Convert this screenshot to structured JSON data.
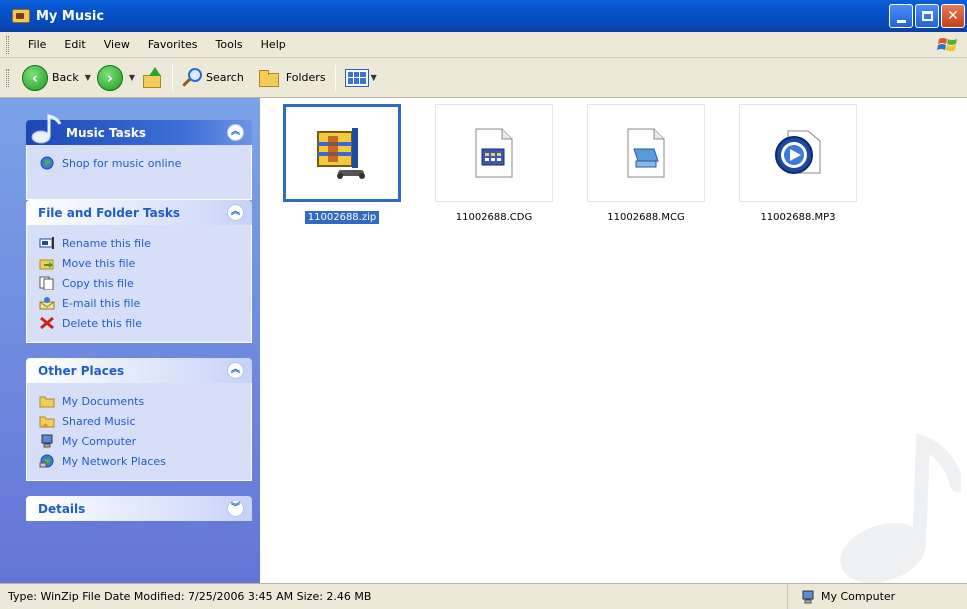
{
  "window": {
    "title": "My Music"
  },
  "menu": [
    "File",
    "Edit",
    "View",
    "Favorites",
    "Tools",
    "Help"
  ],
  "toolbar": {
    "back_label": "Back",
    "search_label": "Search",
    "folders_label": "Folders"
  },
  "taskpane": {
    "music_tasks": {
      "title": "Music Tasks",
      "items": [
        "Shop for music online"
      ]
    },
    "file_folder_tasks": {
      "title": "File and Folder Tasks",
      "items": [
        "Rename this file",
        "Move this file",
        "Copy this file",
        "E-mail this file",
        "Delete this file"
      ]
    },
    "other_places": {
      "title": "Other Places",
      "items": [
        "My Documents",
        "Shared Music",
        "My Computer",
        "My Network Places"
      ]
    },
    "details": {
      "title": "Details"
    }
  },
  "files": [
    {
      "name": "11002688.zip",
      "icon": "winzip-archive-icon",
      "selected": true
    },
    {
      "name": "11002688.CDG",
      "icon": "cdg-file-icon",
      "selected": false
    },
    {
      "name": "11002688.MCG",
      "icon": "mcg-file-icon",
      "selected": false
    },
    {
      "name": "11002688.MP3",
      "icon": "media-player-icon",
      "selected": false
    }
  ],
  "status": {
    "info": "Type: WinZip File Date Modified: 7/25/2006 3:45 AM Size: 2.46 MB",
    "location": "My Computer"
  },
  "colors": {
    "titlebar": "#0551c8",
    "taskpane": "#6f8ee0",
    "selection": "#316ac5",
    "link": "#215dc6"
  }
}
